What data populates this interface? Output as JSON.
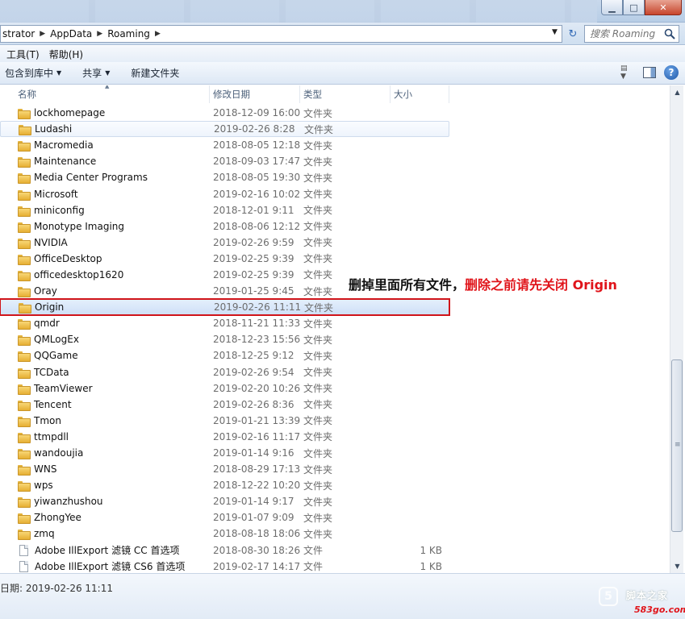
{
  "window": {
    "minimize_glyph": "▁",
    "maximize_glyph": "□",
    "close_glyph": "✕"
  },
  "address": {
    "crumbs": [
      "strator",
      "AppData",
      "Roaming"
    ],
    "dropdown_glyph": "▼",
    "refresh_glyph": "↻",
    "search_placeholder": "搜索 Roaming"
  },
  "menubar": {
    "tools": "工具(T)",
    "help": "帮助(H)"
  },
  "cmdbar": {
    "include_library": "包含到库中",
    "share": "共享",
    "new_folder": "新建文件夹",
    "caret": "▼",
    "help_glyph": "?"
  },
  "columns": {
    "name": "名称",
    "date": "修改日期",
    "type": "类型",
    "size": "大小",
    "sort_caret": "▲"
  },
  "files": [
    {
      "name": "lockhomepage",
      "date": "2018-12-09 16:00",
      "type": "文件夹",
      "size": "",
      "kind": "folder"
    },
    {
      "name": "Ludashi",
      "date": "2019-02-26 8:28",
      "type": "文件夹",
      "size": "",
      "kind": "folder"
    },
    {
      "name": "Macromedia",
      "date": "2018-08-05 12:18",
      "type": "文件夹",
      "size": "",
      "kind": "folder"
    },
    {
      "name": "Maintenance",
      "date": "2018-09-03 17:47",
      "type": "文件夹",
      "size": "",
      "kind": "folder"
    },
    {
      "name": "Media Center Programs",
      "date": "2018-08-05 19:30",
      "type": "文件夹",
      "size": "",
      "kind": "folder"
    },
    {
      "name": "Microsoft",
      "date": "2019-02-16 10:02",
      "type": "文件夹",
      "size": "",
      "kind": "folder"
    },
    {
      "name": "miniconfig",
      "date": "2018-12-01 9:11",
      "type": "文件夹",
      "size": "",
      "kind": "folder"
    },
    {
      "name": "Monotype Imaging",
      "date": "2018-08-06 12:12",
      "type": "文件夹",
      "size": "",
      "kind": "folder"
    },
    {
      "name": "NVIDIA",
      "date": "2019-02-26 9:59",
      "type": "文件夹",
      "size": "",
      "kind": "folder"
    },
    {
      "name": "OfficeDesktop",
      "date": "2019-02-25 9:39",
      "type": "文件夹",
      "size": "",
      "kind": "folder"
    },
    {
      "name": "officedesktop1620",
      "date": "2019-02-25 9:39",
      "type": "文件夹",
      "size": "",
      "kind": "folder"
    },
    {
      "name": "Oray",
      "date": "2019-01-25 9:45",
      "type": "文件夹",
      "size": "",
      "kind": "folder"
    },
    {
      "name": "Origin",
      "date": "2019-02-26 11:11",
      "type": "文件夹",
      "size": "",
      "kind": "folder",
      "selected": true
    },
    {
      "name": "qmdr",
      "date": "2018-11-21 11:33",
      "type": "文件夹",
      "size": "",
      "kind": "folder"
    },
    {
      "name": "QMLogEx",
      "date": "2018-12-23 15:56",
      "type": "文件夹",
      "size": "",
      "kind": "folder"
    },
    {
      "name": "QQGame",
      "date": "2018-12-25 9:12",
      "type": "文件夹",
      "size": "",
      "kind": "folder"
    },
    {
      "name": "TCData",
      "date": "2019-02-26 9:54",
      "type": "文件夹",
      "size": "",
      "kind": "folder"
    },
    {
      "name": "TeamViewer",
      "date": "2019-02-20 10:26",
      "type": "文件夹",
      "size": "",
      "kind": "folder"
    },
    {
      "name": "Tencent",
      "date": "2019-02-26 8:36",
      "type": "文件夹",
      "size": "",
      "kind": "folder"
    },
    {
      "name": "Tmon",
      "date": "2019-01-21 13:39",
      "type": "文件夹",
      "size": "",
      "kind": "folder"
    },
    {
      "name": "ttmpdll",
      "date": "2019-02-16 11:17",
      "type": "文件夹",
      "size": "",
      "kind": "folder"
    },
    {
      "name": "wandoujia",
      "date": "2019-01-14 9:16",
      "type": "文件夹",
      "size": "",
      "kind": "folder"
    },
    {
      "name": "WNS",
      "date": "2018-08-29 17:13",
      "type": "文件夹",
      "size": "",
      "kind": "folder"
    },
    {
      "name": "wps",
      "date": "2018-12-22 10:20",
      "type": "文件夹",
      "size": "",
      "kind": "folder"
    },
    {
      "name": "yiwanzhushou",
      "date": "2019-01-14 9:17",
      "type": "文件夹",
      "size": "",
      "kind": "folder"
    },
    {
      "name": "ZhongYee",
      "date": "2019-01-07 9:09",
      "type": "文件夹",
      "size": "",
      "kind": "folder"
    },
    {
      "name": "zmq",
      "date": "2018-08-18 18:06",
      "type": "文件夹",
      "size": "",
      "kind": "folder"
    },
    {
      "name": "Adobe IllExport 滤镜 CC 首选项",
      "date": "2018-08-30 18:26",
      "type": "文件",
      "size": "1 KB",
      "kind": "file"
    },
    {
      "name": "Adobe IllExport 滤镜 CS6 首选项",
      "date": "2019-02-17 14:17",
      "type": "文件",
      "size": "1 KB",
      "kind": "file"
    }
  ],
  "annotation": {
    "part1": "删掉里面所有文件，",
    "part2": "删除之前请先关闭 Origin"
  },
  "scrollbar": {
    "up_glyph": "▲",
    "down_glyph": "▼",
    "grip_glyph": "≡"
  },
  "details": {
    "text": "日期: 2019-02-26 11:11"
  },
  "watermark": {
    "cn": "脚本之家",
    "url": "583go.com",
    "logo_glyph": "5"
  },
  "colors": {
    "annotation_red": "#e0141a",
    "selection_border": "#d0141a"
  }
}
